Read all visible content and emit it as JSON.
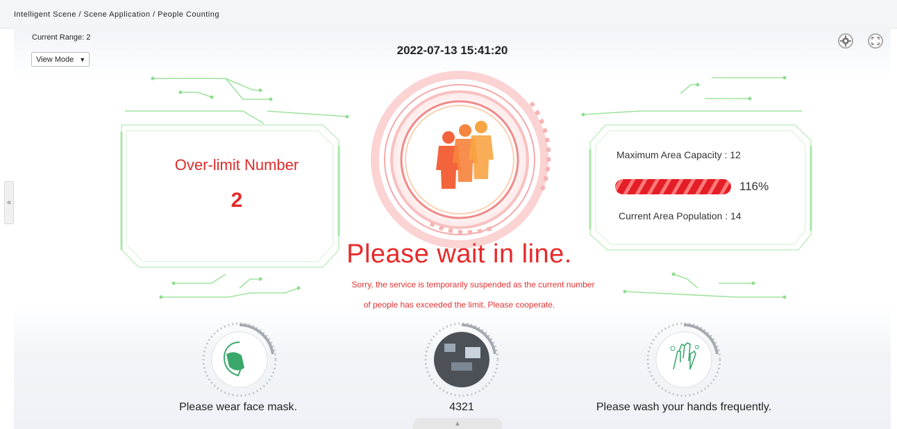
{
  "breadcrumb": "Intelligent Scene / Scene Application / People Counting",
  "range": {
    "label": "Current Range: 2"
  },
  "view_mode": {
    "label": "View Mode"
  },
  "datetime": "2022-07-13 15:41:20",
  "left_panel": {
    "title": "Over-limit Number",
    "value": "2"
  },
  "right_panel": {
    "capacity_label": "Maximum Area Capacity : 12",
    "progress_percent": 116,
    "progress_label": "116%",
    "population_label": "Current Area Population : 14"
  },
  "message": {
    "headline": "Please wait in line.",
    "line1": "Sorry, the service is temporarily suspended as the current number",
    "line2": "of people has exceeded the limit. Please cooperate."
  },
  "tips": [
    {
      "caption": "Please wear face mask.",
      "icon": "face-mask-icon"
    },
    {
      "caption": "4321",
      "icon": "media-thumbnail"
    },
    {
      "caption": "Please wash your hands frequently.",
      "icon": "hand-wash-icon"
    }
  ],
  "icons": {
    "collapse": "«",
    "bottom_toggle": "▲",
    "dropdown": "▼"
  },
  "colors": {
    "alert_red": "#e62a2a",
    "circuit_green": "#8fdd8f",
    "ring_red": "#f08a8a",
    "people_orange": "#f06a3e"
  }
}
